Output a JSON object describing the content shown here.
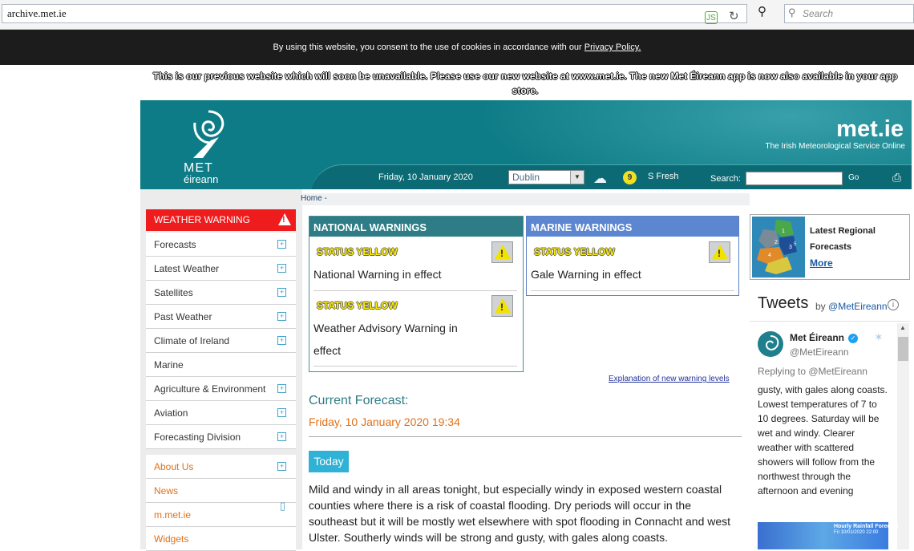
{
  "browser": {
    "url": "archive.met.ie",
    "search_placeholder": "Search"
  },
  "cookie": {
    "text": "By using this website, you consent to the use of cookies in accordance with our ",
    "link": "Privacy Policy."
  },
  "notice": "This is our previous website which will soon be unavailable. Please use our new website at www.met.ie. The new Met Éireann app is now also available in your app store.",
  "header": {
    "logo_line1": "MET",
    "logo_line2": "éireann",
    "brand": "met.ie",
    "tagline": "The Irish Meteorological Service Online",
    "date": "Friday, 10 January 2020",
    "location": "Dublin",
    "wind_force": "9",
    "wind_text": "S Fresh",
    "search_label": "Search:",
    "go_label": "Go"
  },
  "sidebar": {
    "warning_label": "WEATHER WARNING",
    "items": [
      {
        "label": "Forecasts"
      },
      {
        "label": "Latest Weather"
      },
      {
        "label": "Satellites"
      },
      {
        "label": "Past Weather"
      },
      {
        "label": "Climate of Ireland"
      },
      {
        "label": "Marine"
      },
      {
        "label": "Agriculture & Environment"
      },
      {
        "label": "Aviation"
      },
      {
        "label": "Forecasting Division"
      }
    ],
    "secondary": [
      {
        "label": "About Us"
      },
      {
        "label": "News"
      },
      {
        "label": "m.met.ie"
      },
      {
        "label": "Widgets"
      }
    ]
  },
  "breadcrumb": "Home -",
  "national": {
    "title": "NATIONAL WARNINGS",
    "items": [
      {
        "status": "STATUS YELLOW",
        "text": "National Warning in effect"
      },
      {
        "status": "STATUS YELLOW",
        "text1": "Weather Advisory Warning in",
        "text2": "effect"
      }
    ]
  },
  "marine": {
    "title": "MARINE WARNINGS",
    "items": [
      {
        "status": "STATUS YELLOW",
        "text": "Gale Warning in effect"
      }
    ]
  },
  "explanation_link": "Explanation of new warning levels",
  "forecast": {
    "title": "Current Forecast:",
    "datetime": "Friday, 10 January 2020 19:34",
    "today": "Today",
    "text": "Mild and windy in all areas tonight, but especially windy in exposed western coastal counties where there is a risk of coastal flooding. Dry periods will occur in the southeast but it will be mostly wet elsewhere with spot flooding in Connacht and west Ulster. Southerly winds will be strong and gusty, with gales along coasts."
  },
  "regional": {
    "title1": "Latest Regional",
    "title2": "Forecasts",
    "more": "More",
    "map_labels": [
      "1",
      "2",
      "3",
      "4",
      "5"
    ]
  },
  "tweets": {
    "title": "Tweets",
    "by": "by ",
    "handle_link": "@MetEireann",
    "name": "Met Éireann",
    "handle": "@MetEireann",
    "reply": "Replying to @MetEireann",
    "body": "gusty, with gales along coasts. Lowest temperatures of 7 to 10 degrees. Saturday will be wet and windy. Clearer weather with scattered showers will follow from the northwest through the afternoon and evening"
  },
  "rain": {
    "title": "Hourly Rainfall Forecast",
    "date": "Fri 10/01/2020 22:00"
  },
  "colors": {
    "teal": "#0e7c86",
    "warning_red": "#ee1c1c",
    "orange": "#e27018",
    "today_blue": "#30b2d6",
    "status_yellow": "#ffee00"
  }
}
